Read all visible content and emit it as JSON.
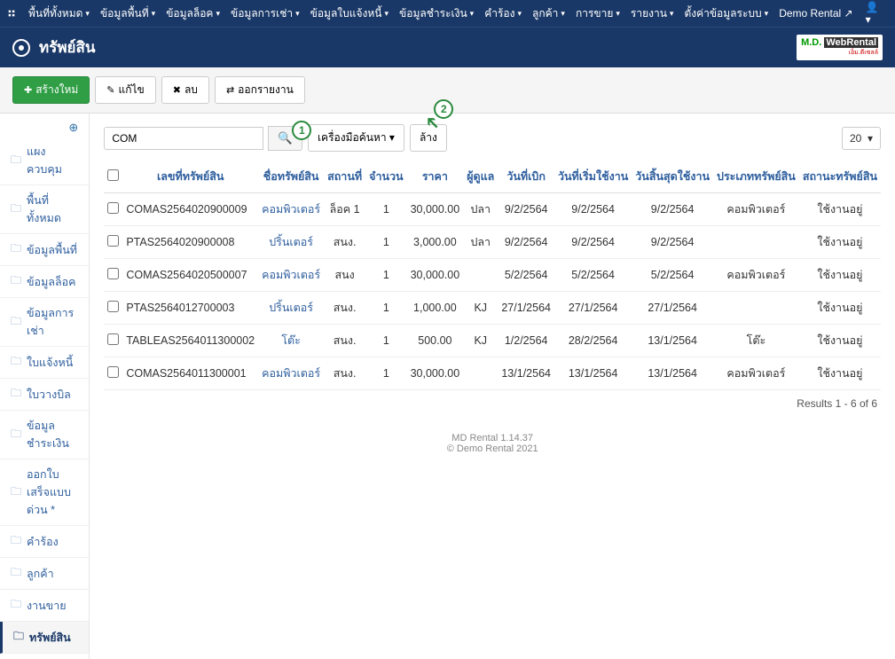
{
  "topnav": {
    "items": [
      "พื้นที่ทั้งหมด",
      "ข้อมูลพื้นที่",
      "ข้อมูลล็อค",
      "ข้อมูลการเช่า",
      "ข้อมูลใบแจ้งหนี้",
      "ข้อมูลชำระเงิน",
      "คำร้อง",
      "ลูกค้า",
      "การขาย",
      "รายงาน",
      "ตั้งค่าข้อมูลระบบ"
    ],
    "site": "Demo Rental"
  },
  "page_title": "ทรัพย์สิน",
  "brand": {
    "main1": "M.D.",
    "main2": "WebRental",
    "sub": "เอ็ม.ดีเซลล์"
  },
  "toolbar": {
    "new": "สร้างใหม่",
    "edit": "แก้ไข",
    "delete": "ลบ",
    "export": "ออกรายงาน"
  },
  "sidebar": {
    "items": [
      {
        "label": "แผงควบคุม"
      },
      {
        "label": "พื้นที่ทั้งหมด"
      },
      {
        "label": "ข้อมูลพื้นที่"
      },
      {
        "label": "ข้อมูลล็อค"
      },
      {
        "label": "ข้อมูลการเช่า"
      },
      {
        "label": "ใบแจ้งหนี้"
      },
      {
        "label": "ใบวางบิล"
      },
      {
        "label": "ข้อมูลชำระเงิน"
      },
      {
        "label": "ออกใบเสร็จแบบด่วน *"
      },
      {
        "label": "คำร้อง"
      },
      {
        "label": "ลูกค้า"
      },
      {
        "label": "งานขาย"
      },
      {
        "label": "ทรัพย์สิน",
        "active": true
      }
    ]
  },
  "filter": {
    "search_value": "COM",
    "tools": "เครื่องมือค้นหา",
    "clear": "ล้าง",
    "limit": "20"
  },
  "table": {
    "headers": [
      "เลขที่ทรัพย์สิน",
      "ชื่อทรัพย์สิน",
      "สถานที่",
      "จำนวน",
      "ราคา",
      "ผู้ดูแล",
      "วันที่เบิก",
      "วันที่เริ่มใช้งาน",
      "วันสิ้นสุดใช้งาน",
      "ประเภททรัพย์สิน",
      "สถานะทรัพย์สิน"
    ],
    "rows": [
      {
        "no": "COMAS2564020900009",
        "name": "คอมพิวเตอร์",
        "loc": "ล็อค 1",
        "qty": "1",
        "price": "30,000.00",
        "keeper": "ปลา",
        "d1": "9/2/2564",
        "d2": "9/2/2564",
        "d3": "9/2/2564",
        "type": "คอมพิวเตอร์",
        "status": "ใช้งานอยู่"
      },
      {
        "no": "PTAS2564020900008",
        "name": "ปริ้นเตอร์",
        "loc": "สนง.",
        "qty": "1",
        "price": "3,000.00",
        "keeper": "ปลา",
        "d1": "9/2/2564",
        "d2": "9/2/2564",
        "d3": "9/2/2564",
        "type": "",
        "status": "ใช้งานอยู่"
      },
      {
        "no": "COMAS2564020500007",
        "name": "คอมพิวเตอร์",
        "loc": "สนง",
        "qty": "1",
        "price": "30,000.00",
        "keeper": "",
        "d1": "5/2/2564",
        "d2": "5/2/2564",
        "d3": "5/2/2564",
        "type": "คอมพิวเตอร์",
        "status": "ใช้งานอยู่"
      },
      {
        "no": "PTAS2564012700003",
        "name": "ปริ้นเตอร์",
        "loc": "สนง.",
        "qty": "1",
        "price": "1,000.00",
        "keeper": "KJ",
        "d1": "27/1/2564",
        "d2": "27/1/2564",
        "d3": "27/1/2564",
        "type": "",
        "status": "ใช้งานอยู่"
      },
      {
        "no": "TABLEAS2564011300002",
        "name": "โต๊ะ",
        "loc": "สนง.",
        "qty": "1",
        "price": "500.00",
        "keeper": "KJ",
        "d1": "1/2/2564",
        "d2": "28/2/2564",
        "d3": "13/1/2564",
        "type": "โต๊ะ",
        "status": "ใช้งานอยู่"
      },
      {
        "no": "COMAS2564011300001",
        "name": "คอมพิวเตอร์",
        "loc": "สนง.",
        "qty": "1",
        "price": "30,000.00",
        "keeper": "",
        "d1": "13/1/2564",
        "d2": "13/1/2564",
        "d3": "13/1/2564",
        "type": "คอมพิวเตอร์",
        "status": "ใช้งานอยู่"
      }
    ],
    "results": "Results 1 - 6 of 6"
  },
  "footer": {
    "line1": "MD Rental 1.14.37",
    "line2": "© Demo Rental 2021"
  },
  "callouts": {
    "c1": "1",
    "c2": "2"
  }
}
